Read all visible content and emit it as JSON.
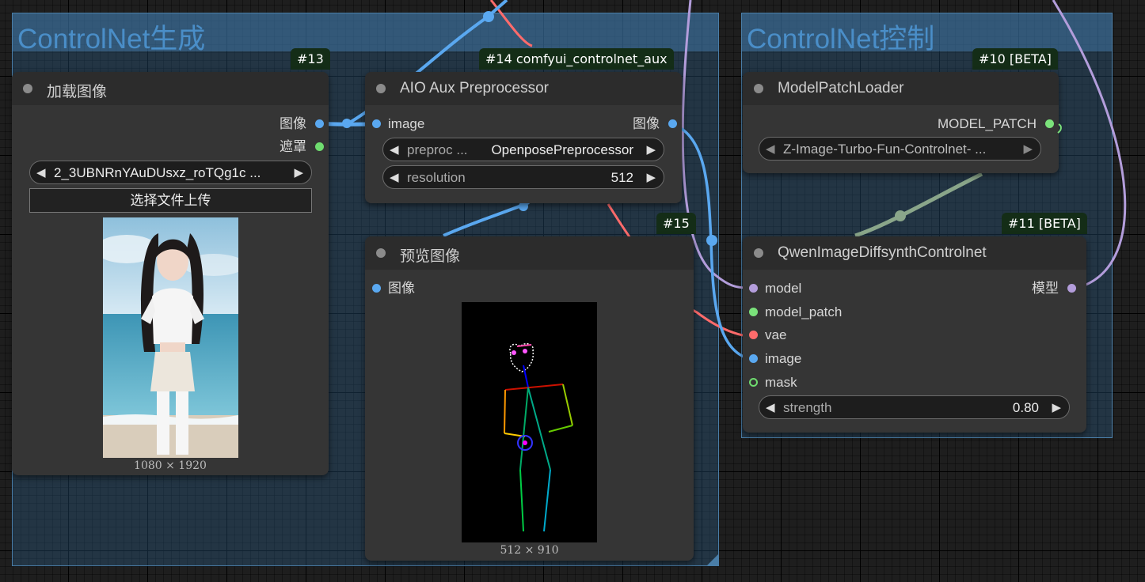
{
  "groups": [
    {
      "title": "ControlNet生成"
    },
    {
      "title": "ControlNet控制"
    }
  ],
  "badges": {
    "n13": "#13",
    "n14": "#14 comfyui_controlnet_aux",
    "n10": "#10 [BETA]",
    "n15": "#15",
    "n11": "#11 [BETA]"
  },
  "load_image": {
    "title": "加载图像",
    "outputs": [
      "图像",
      "遮罩"
    ],
    "file": "2_3UBNRnYAuDUsxz_roTQg1c ...",
    "upload_label": "选择文件上传",
    "size_caption": "1080 × 1920"
  },
  "aio_preprocessor": {
    "title": "AIO Aux Preprocessor",
    "input": "image",
    "output": "图像",
    "preprocessor": {
      "name": "preproc ...",
      "value": "OpenposePreprocessor"
    },
    "resolution": {
      "name": "resolution",
      "value": "512"
    }
  },
  "preview_image": {
    "title": "预览图像",
    "input": "图像",
    "size_caption": "512 × 910"
  },
  "model_patch_loader": {
    "title": "ModelPatchLoader",
    "output": "MODEL_PATCH",
    "patch_name": "Z-Image-Turbo-Fun-Controlnet-   ..."
  },
  "qwen_controlnet": {
    "title": "QwenImageDiffsynthControlnet",
    "inputs": [
      "model",
      "model_patch",
      "vae",
      "image",
      "mask"
    ],
    "output": "模型",
    "strength": {
      "name": "strength",
      "value": "0.80"
    }
  },
  "colors": {
    "image": "#5aa8f0",
    "mask": "#6fdc6f",
    "model": "#b39ddb",
    "vae": "#ff6b6b",
    "model_patch": "#7be27b",
    "model_patch_link": "#8aa68a"
  }
}
